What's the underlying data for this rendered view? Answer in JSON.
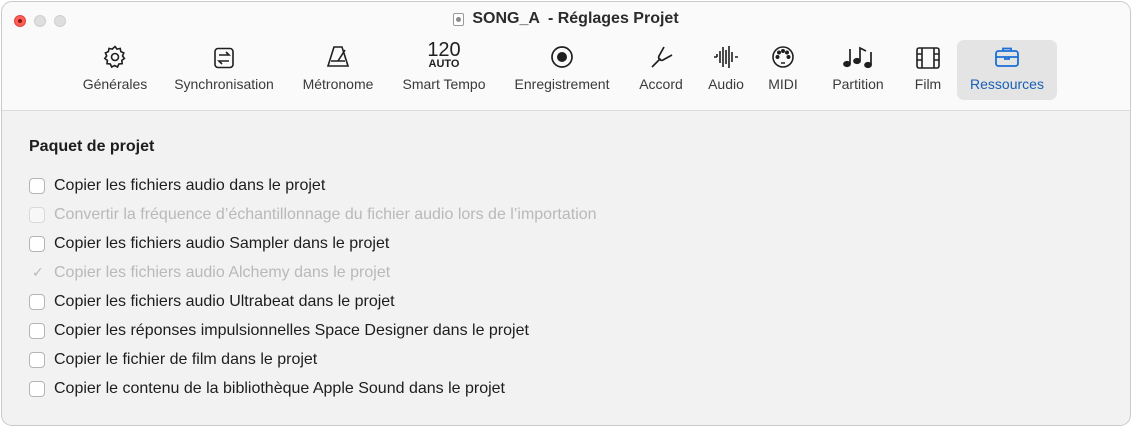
{
  "window": {
    "title": "SONG_A",
    "title_suffix": "- Réglages Projet"
  },
  "toolbar": {
    "tabs": [
      {
        "id": "generales",
        "label": "Générales",
        "icon": "gear-icon"
      },
      {
        "id": "synchronisation",
        "label": "Synchronisation",
        "icon": "sync-icon"
      },
      {
        "id": "metronome",
        "label": "Métronome",
        "icon": "metronome-icon"
      },
      {
        "id": "smart-tempo",
        "label": "Smart Tempo",
        "icon": "tempo-readout",
        "tempo_value": "120",
        "tempo_mode": "AUTO"
      },
      {
        "id": "enregistrement",
        "label": "Enregistrement",
        "icon": "record-icon"
      },
      {
        "id": "accord",
        "label": "Accord",
        "icon": "tuning-fork-icon"
      },
      {
        "id": "audio",
        "label": "Audio",
        "icon": "waveform-icon"
      },
      {
        "id": "midi",
        "label": "MIDI",
        "icon": "midi-port-icon"
      },
      {
        "id": "partition",
        "label": "Partition",
        "icon": "notes-icon"
      },
      {
        "id": "film",
        "label": "Film",
        "icon": "film-icon"
      },
      {
        "id": "ressources",
        "label": "Ressources",
        "icon": "briefcase-icon",
        "selected": true
      }
    ]
  },
  "content": {
    "section_title": "Paquet de projet",
    "options": [
      {
        "label": "Copier les fichiers audio dans le projet",
        "checked": false,
        "enabled": true
      },
      {
        "label": "Convertir la fréquence d’échantillonnage du fichier audio lors de l’importation",
        "checked": false,
        "enabled": false
      },
      {
        "label": "Copier les fichiers audio Sampler dans le projet",
        "checked": false,
        "enabled": true
      },
      {
        "label": "Copier les fichiers audio Alchemy dans le projet",
        "checked": true,
        "enabled": false
      },
      {
        "label": "Copier les fichiers audio Ultrabeat dans le projet",
        "checked": false,
        "enabled": true
      },
      {
        "label": "Copier les réponses impulsionnelles Space Designer dans le projet",
        "checked": false,
        "enabled": true
      },
      {
        "label": "Copier le fichier de film dans le projet",
        "checked": false,
        "enabled": true
      },
      {
        "label": "Copier le contenu de la bibliothèque Apple Sound dans le projet",
        "checked": false,
        "enabled": true
      }
    ]
  },
  "colors": {
    "accent": "#1a6fd6",
    "selected_tab_bg": "#e4e4e4",
    "close_button": "#ff5f57"
  }
}
